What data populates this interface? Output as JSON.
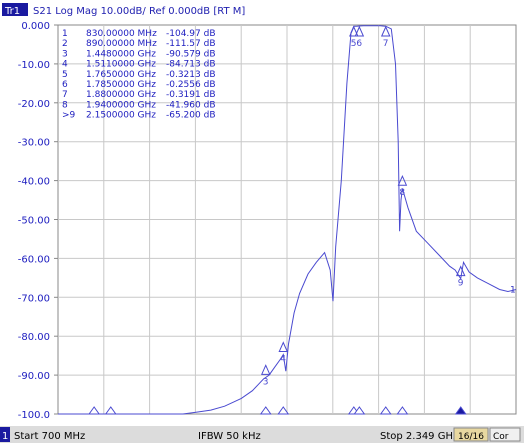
{
  "header": {
    "trace_label": "Tr1",
    "parameters": "S21  Log Mag 10.00dB/ Ref 0.000dB [RT M]"
  },
  "markers": [
    {
      "id": "1",
      "prefix": " ",
      "freq": "830.00000 MHz",
      "value": "-104.97 dB"
    },
    {
      "id": "2",
      "prefix": " ",
      "freq": "890.00000 MHz",
      "value": "-111.57 dB"
    },
    {
      "id": "3",
      "prefix": " ",
      "freq": "1.4480000 GHz",
      "value": "-90.579 dB"
    },
    {
      "id": "4",
      "prefix": " ",
      "freq": "1.5110000 GHz",
      "value": "-84.713 dB"
    },
    {
      "id": "5",
      "prefix": " ",
      "freq": "1.7650000 GHz",
      "value": "-0.3213 dB"
    },
    {
      "id": "6",
      "prefix": " ",
      "freq": "1.7850000 GHz",
      "value": "-0.2556 dB"
    },
    {
      "id": "7",
      "prefix": " ",
      "freq": "1.8800000 GHz",
      "value": "-0.3191 dB"
    },
    {
      "id": "8",
      "prefix": " ",
      "freq": "1.9400000 GHz",
      "value": "-41.960 dB"
    },
    {
      "id": "9",
      "prefix": ">",
      "freq": "2.1500000 GHz",
      "value": "-65.200 dB"
    }
  ],
  "chart_data": {
    "type": "line",
    "title": "S21  Log Mag 10.00dB/ Ref 0.000dB [RT M]",
    "xlabel": "",
    "ylabel": "",
    "x_unit": "GHz",
    "xlim": [
      0.7,
      2.349
    ],
    "ylim": [
      -100,
      0
    ],
    "y_ticks": [
      "0.000",
      "-10.00",
      "-20.00",
      "-30.00",
      "-40.00",
      "-50.00",
      "-60.00",
      "-70.00",
      "-80.00",
      "-90.00",
      "-100.0"
    ],
    "grid": true,
    "trace_color": "#4a4ad0",
    "series": [
      {
        "name": "S21",
        "x": [
          0.7,
          0.75,
          0.8,
          0.85,
          0.9,
          0.95,
          1.0,
          1.05,
          1.1,
          1.15,
          1.2,
          1.25,
          1.3,
          1.33,
          1.36,
          1.4,
          1.42,
          1.44,
          1.46,
          1.48,
          1.5,
          1.511,
          1.52,
          1.53,
          1.55,
          1.57,
          1.6,
          1.63,
          1.66,
          1.68,
          1.69,
          1.7,
          1.72,
          1.74,
          1.755,
          1.765,
          1.775,
          1.785,
          1.8,
          1.83,
          1.86,
          1.88,
          1.9,
          1.915,
          1.925,
          1.93,
          1.935,
          1.94,
          1.96,
          1.99,
          2.03,
          2.07,
          2.11,
          2.13,
          2.15,
          2.16,
          2.18,
          2.21,
          2.25,
          2.29,
          2.32,
          2.349
        ],
        "y": [
          -100,
          -100,
          -100,
          -100,
          -100,
          -100,
          -100,
          -100,
          -100,
          -100,
          -99.5,
          -99,
          -98,
          -97,
          -96,
          -94,
          -92.5,
          -91,
          -90,
          -88,
          -86,
          -84.7,
          -89,
          -82,
          -74,
          -69,
          -64,
          -61,
          -58.5,
          -63,
          -71,
          -57,
          -40,
          -15,
          -2,
          -0.32,
          -0.3,
          -0.26,
          -0.2,
          -0.2,
          -0.2,
          -0.32,
          -1,
          -10,
          -30,
          -53,
          -45,
          -42,
          -47,
          -53,
          -56,
          -59,
          -62,
          -63,
          -65.2,
          -61,
          -63.5,
          -65,
          -66.5,
          -68,
          -68.5,
          -68
        ]
      }
    ],
    "marker_flags": [
      {
        "id": "1",
        "x": 0.83,
        "y": -104.97
      },
      {
        "id": "2",
        "x": 0.89,
        "y": -111.57
      },
      {
        "id": "3",
        "x": 1.448,
        "y": -90.579
      },
      {
        "id": "4",
        "x": 1.511,
        "y": -84.713
      },
      {
        "id": "5",
        "x": 1.765,
        "y": -0.3213
      },
      {
        "id": "6",
        "x": 1.785,
        "y": -0.2556
      },
      {
        "id": "7",
        "x": 1.88,
        "y": -0.3191
      },
      {
        "id": "8",
        "x": 1.94,
        "y": -41.96
      },
      {
        "id": "9",
        "x": 2.15,
        "y": -65.2
      }
    ],
    "active_marker": "9",
    "trace_end_label": "1"
  },
  "status_bar": {
    "channel": "1",
    "start": "Start 700 MHz",
    "ifbw": "IFBW 50 kHz",
    "stop": "Stop 2.349 GHz",
    "points": "16/16",
    "correction": "Cor"
  },
  "colors": {
    "trace": "#4a4ad0",
    "grid": "#c8c8c8",
    "axis_text": "#2020c0",
    "frame": "#888888",
    "status_bg": "#dcdcdc"
  }
}
